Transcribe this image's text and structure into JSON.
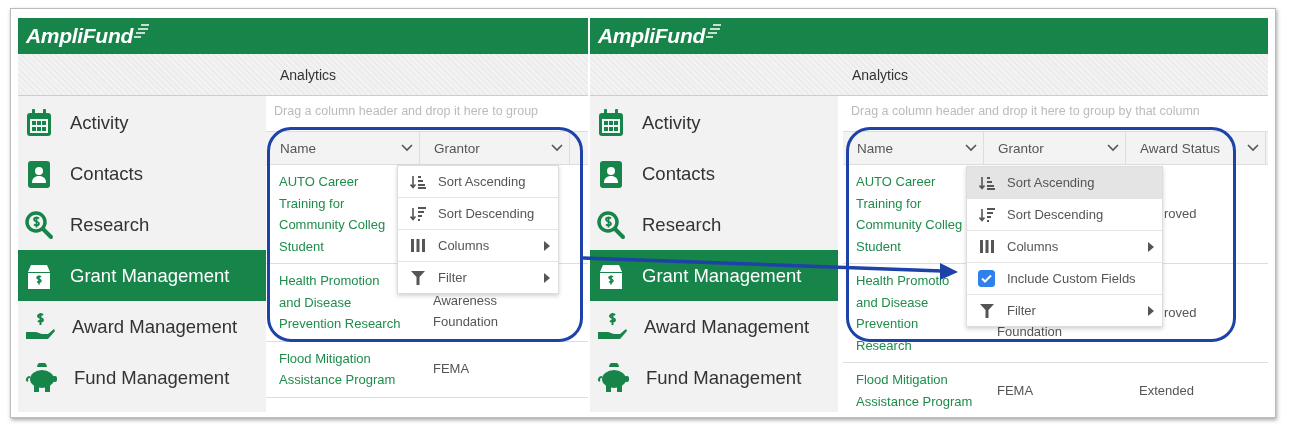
{
  "panels": [
    {
      "logo": "AmpliFund",
      "breadcrumb": "Analytics",
      "sidebar": [
        {
          "label": "Activity",
          "selected": false
        },
        {
          "label": "Contacts",
          "selected": false
        },
        {
          "label": "Research",
          "selected": false
        },
        {
          "label": "Grant Management",
          "selected": true
        },
        {
          "label": "Award Management",
          "selected": false
        },
        {
          "label": "Fund Management",
          "selected": false
        }
      ],
      "grid": {
        "drop_hint": "Drag a column header and drop it here to group",
        "columns": [
          {
            "label": "Name"
          },
          {
            "label": "Grantor"
          }
        ],
        "rows": [
          {
            "name": "AUTO Career\nTraining for\nCommunity Colleg\nStudent"
          },
          {
            "name": "Health Promotion\nand Disease\nPrevention Research",
            "grantor": "Awareness\nFoundation"
          },
          {
            "name": "Flood Mitigation\nAssistance Program",
            "grantor": "FEMA"
          }
        ]
      },
      "menu": [
        {
          "label": "Sort Ascending",
          "kind": "sort-asc",
          "highlighted": false,
          "submenu": false
        },
        {
          "label": "Sort Descending",
          "kind": "sort-desc",
          "highlighted": false,
          "submenu": false
        },
        {
          "label": "Columns",
          "kind": "columns",
          "highlighted": false,
          "submenu": true
        },
        {
          "label": "Filter",
          "kind": "filter",
          "highlighted": false,
          "submenu": true
        }
      ]
    },
    {
      "logo": "AmpliFund",
      "breadcrumb": "Analytics",
      "sidebar": [
        {
          "label": "Activity",
          "selected": false
        },
        {
          "label": "Contacts",
          "selected": false
        },
        {
          "label": "Research",
          "selected": false
        },
        {
          "label": "Grant Management",
          "selected": true
        },
        {
          "label": "Award Management",
          "selected": false
        },
        {
          "label": "Fund Management",
          "selected": false
        }
      ],
      "grid": {
        "drop_hint": "Drag a column header and drop it here to group by that column",
        "columns": [
          {
            "label": "Name"
          },
          {
            "label": "Grantor"
          },
          {
            "label": "Award Status"
          }
        ],
        "rows": [
          {
            "name": "AUTO Career\nTraining for\nCommunity Colleg\nStudent",
            "award_status": "roved"
          },
          {
            "name": "Health Promotio\nand Disease\nPrevention\nResearch",
            "grantor": "Foundation",
            "award_status": "roved"
          },
          {
            "name": "Flood Mitigation\nAssistance Program",
            "grantor": "FEMA",
            "award_status": "Extended"
          }
        ]
      },
      "menu": [
        {
          "label": "Sort Ascending",
          "kind": "sort-asc",
          "highlighted": true,
          "submenu": false
        },
        {
          "label": "Sort Descending",
          "kind": "sort-desc",
          "highlighted": false,
          "submenu": false
        },
        {
          "label": "Columns",
          "kind": "columns",
          "highlighted": false,
          "submenu": true
        },
        {
          "label": "Include Custom Fields",
          "kind": "checkbox",
          "checked": true,
          "highlighted": false,
          "submenu": false
        },
        {
          "label": "Filter",
          "kind": "filter",
          "highlighted": false,
          "submenu": true
        }
      ]
    }
  ]
}
